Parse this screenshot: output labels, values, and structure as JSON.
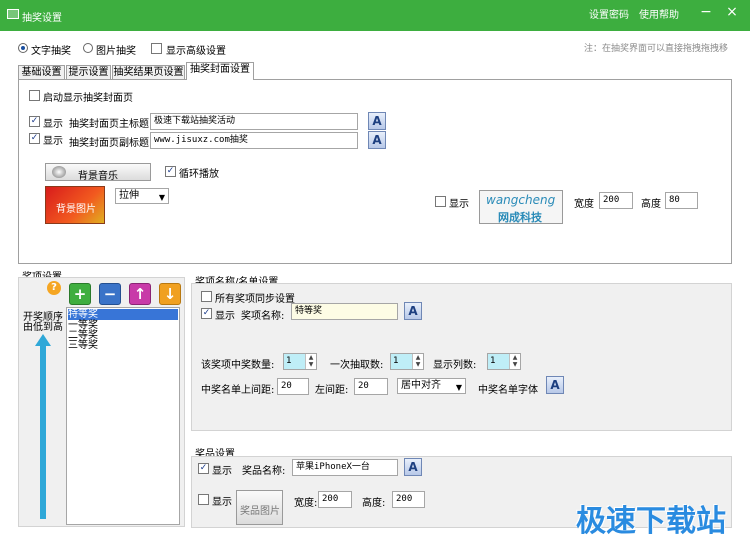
{
  "window": {
    "title": "抽奖设置",
    "password_link": "设置密码",
    "help_link": "使用帮助",
    "minimize_glyph": "−",
    "close_glyph": "×"
  },
  "mode": {
    "text_label": "文字抽奖",
    "image_label": "图片抽奖",
    "advanced_label": "显示高级设置",
    "selected": "文字抽奖",
    "hint": "注：在抽奖界面可以直接拖拽拖拽移"
  },
  "tabs": [
    {
      "label": "基础设置"
    },
    {
      "label": "提示设置"
    },
    {
      "label": "抽奖结果页设置"
    },
    {
      "label": "抽奖封面设置"
    }
  ],
  "cover": {
    "enable_label": "启动显示抽奖封面页",
    "enable_checked": false,
    "show_label": "显示",
    "main_title_label": "抽奖封面页主标题",
    "main_title_value": "极速下载站抽奖活动",
    "main_title_checked": true,
    "sub_title_label": "抽奖封面页副标题",
    "sub_title_value": "www.jisuxz.com抽奖",
    "sub_title_checked": true,
    "font_glyph": "A",
    "music_button": "背景音乐",
    "loop_label": "循环播放",
    "loop_checked": true,
    "bg_image_label": "背景图片",
    "stretch_value": "拉伸",
    "logo_show_label": "显示",
    "logo_show_checked": false,
    "logo_text_top": "wangcheng",
    "logo_text_bottom": "网成科技",
    "width_label": "宽度",
    "width_value": "200",
    "height_label": "高度",
    "height_value": "80"
  },
  "prize_items": {
    "title": "奖项设置",
    "help_glyph": "?",
    "order_label_1": "开奖顺序",
    "order_label_2": "由低到高",
    "buttons": {
      "add": "+",
      "remove": "−",
      "up": "↑",
      "down": "↓"
    },
    "items": [
      "特等奖",
      "一等奖",
      "二等奖",
      "三等奖"
    ],
    "selected": "特等奖"
  },
  "names": {
    "title": "奖项名称/名单设置",
    "sync_label": "所有奖项同步设置",
    "sync_checked": false,
    "show_label": "显示",
    "show_checked": true,
    "name_label": "奖项名称:",
    "name_value": "特等奖",
    "count_label": "该奖项中奖数量:",
    "count_value": "1",
    "draw_label": "一次抽取数:",
    "draw_value": "1",
    "cols_label": "显示列数:",
    "cols_value": "1",
    "top_margin_label": "中奖名单上间距:",
    "top_margin_value": "20",
    "left_margin_label": "左间距:",
    "left_margin_value": "20",
    "align_value": "居中对齐",
    "font_label": "中奖名单字体"
  },
  "prize": {
    "title": "奖品设置",
    "show_label": "显示",
    "show_checked": true,
    "name_label": "奖品名称:",
    "name_value": "苹果iPhoneX一台",
    "img_show_label": "显示",
    "img_show_checked": false,
    "img_button": "奖品图片",
    "width_label": "宽度:",
    "width_value": "200",
    "height_label": "高度:",
    "height_value": "200"
  },
  "watermark": "极速下载站",
  "colors": {
    "titlebar": "#3dae3f",
    "accent": "#1d3f80"
  }
}
